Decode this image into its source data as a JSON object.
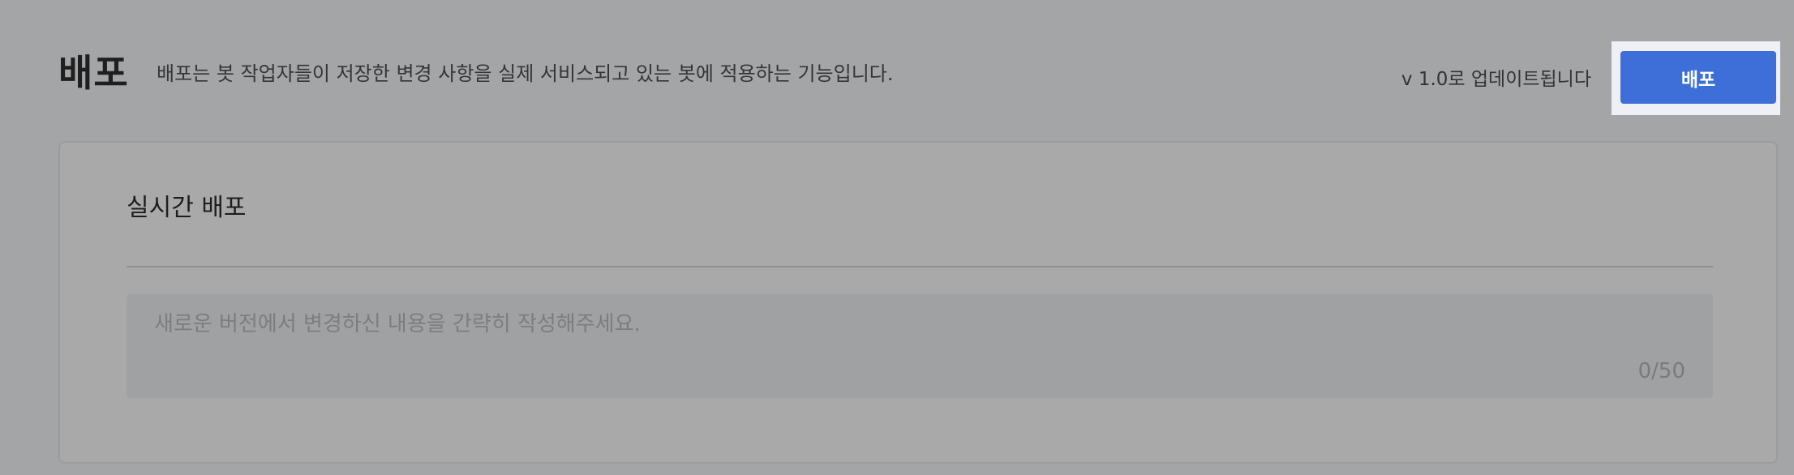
{
  "header": {
    "title": "배포",
    "description": "배포는 봇 작업자들이 저장한 변경 사항을 실제 서비스되고 있는 봇에 적용하는 기능입니다.",
    "version_notice": "v 1.0로 업데이트됩니다",
    "deploy_button_label": "배포"
  },
  "card": {
    "title": "실시간 배포",
    "note": {
      "placeholder": "새로운 버전에서 변경하신 내용을 간략히 작성해주세요.",
      "value": "",
      "counter": "0/50"
    }
  },
  "colors": {
    "accent": "#3e6fd8",
    "overlay_bg": "#a4a5a7",
    "highlight_frame": "#eef0f6"
  }
}
